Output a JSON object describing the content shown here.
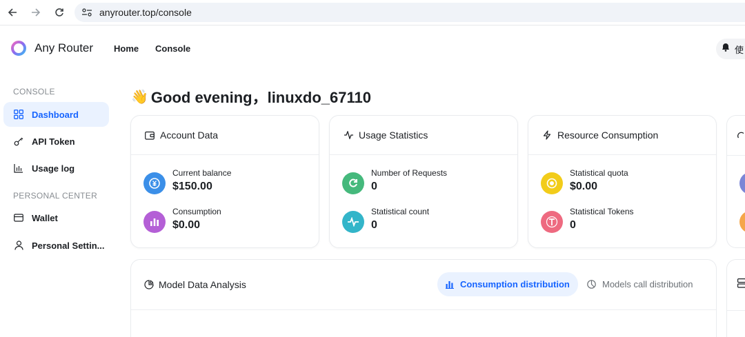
{
  "browser": {
    "url": "anyrouter.top/console"
  },
  "header": {
    "brand": "Any Router",
    "nav": [
      {
        "label": "Home"
      },
      {
        "label": "Console"
      }
    ],
    "notice_text": "使"
  },
  "sidebar": {
    "sections": [
      {
        "label": "CONSOLE"
      },
      {
        "label": "PERSONAL CENTER"
      }
    ],
    "items": [
      {
        "label": "Dashboard",
        "icon": "dashboard-icon",
        "active": true
      },
      {
        "label": "API Token",
        "icon": "key-icon"
      },
      {
        "label": "Usage log",
        "icon": "bar-chart-icon"
      },
      {
        "label": "Wallet",
        "icon": "wallet-icon"
      },
      {
        "label": "Personal Settin...",
        "icon": "user-icon"
      }
    ]
  },
  "main": {
    "greeting": "Good evening，linuxdo_67110",
    "greeting_emoji": "👋",
    "cards": [
      {
        "title": "Account Data",
        "icon": "wallet-card-icon",
        "stats": [
          {
            "label": "Current balance",
            "value": "$150.00",
            "icon": "yen-coin-icon",
            "color": "#3b8fe8"
          },
          {
            "label": "Consumption",
            "value": "$0.00",
            "icon": "bar-chart-icon",
            "color": "#b45fd6"
          }
        ]
      },
      {
        "title": "Usage Statistics",
        "icon": "pulse-icon",
        "stats": [
          {
            "label": "Number of Requests",
            "value": "0",
            "icon": "refresh-icon",
            "color": "#45b97c"
          },
          {
            "label": "Statistical count",
            "value": "0",
            "icon": "pulse-icon",
            "color": "#33b5c9"
          }
        ]
      },
      {
        "title": "Resource Consumption",
        "icon": "lightning-icon",
        "stats": [
          {
            "label": "Statistical quota",
            "value": "$0.00",
            "icon": "coin-icon",
            "color": "#f2cc1a"
          },
          {
            "label": "Statistical Tokens",
            "value": "0",
            "icon": "t-letter-icon",
            "color": "#ee6a80"
          }
        ]
      }
    ],
    "analysis": {
      "title": "Model Data Analysis",
      "tabs": [
        {
          "label": "Consumption distribution",
          "active": true
        },
        {
          "label": "Models call distribution",
          "active": false
        }
      ]
    }
  },
  "colors": {
    "accent": "#1664ff",
    "active_bg": "#eaf2ff"
  }
}
